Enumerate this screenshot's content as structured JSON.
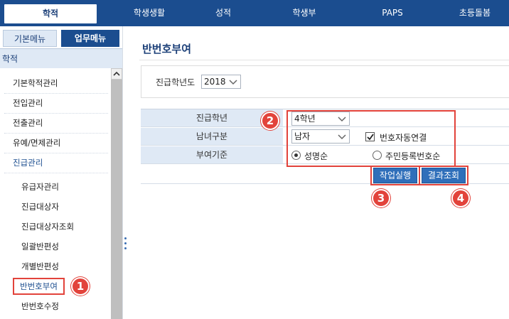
{
  "topnav": {
    "tabs": [
      "학적",
      "학생생활",
      "성적",
      "학생부",
      "PAPS",
      "초등돌봄"
    ],
    "active_index": 0
  },
  "sidebar": {
    "tab_basic": "기본메뉴",
    "tab_work": "업무메뉴",
    "section": "학적",
    "items": [
      "기본학적관리",
      "전입관리",
      "전출관리",
      "유예/면제관리",
      "진급관리"
    ],
    "sub_items": [
      "유급자관리",
      "진급대상자",
      "진급대상자조회",
      "일괄반편성",
      "개별반편성",
      "반번호부여",
      "반번호수정"
    ],
    "current_sub": "반번호부여"
  },
  "main": {
    "title": "반번호부여",
    "filter": {
      "label": "진급학년도",
      "year": "2018"
    },
    "form": {
      "grade_label": "진급학년",
      "grade_value": "4학년",
      "gender_label": "남녀구분",
      "gender_value": "남자",
      "auto_link_label": "번호자동연결",
      "auto_link_checked": true,
      "criteria_label": "부여기준",
      "criteria_options": [
        "성명순",
        "주민등록번호순"
      ],
      "criteria_selected": "성명순"
    },
    "buttons": {
      "run": "작업실행",
      "result": "결과조회"
    }
  },
  "annotations": [
    "1",
    "2",
    "3",
    "4"
  ],
  "colors": {
    "nav": "#1b4d8f",
    "accent_red": "#e2433b",
    "label_bg": "#dfe9f5",
    "button": "#2f6fba"
  }
}
